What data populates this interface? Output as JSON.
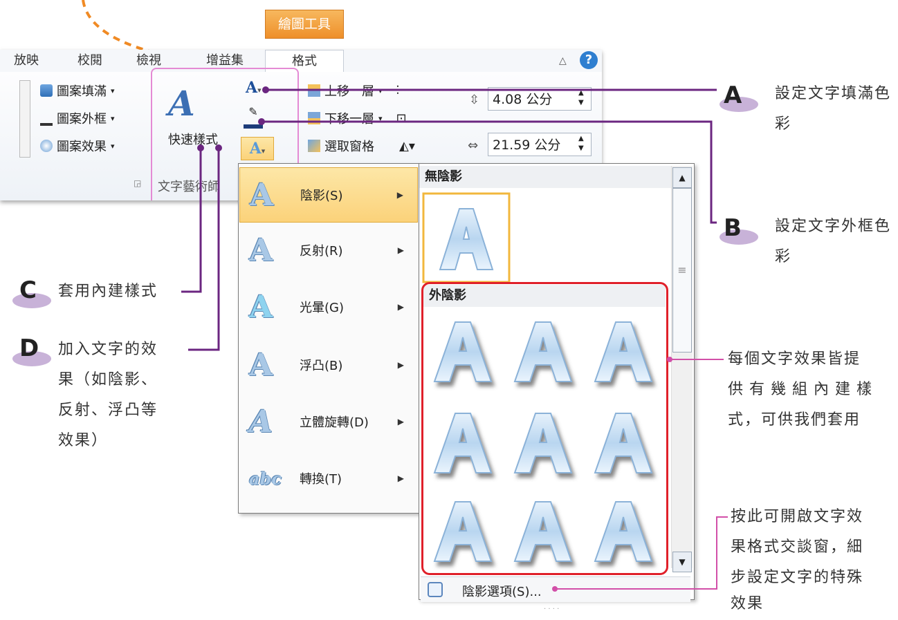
{
  "ribbon": {
    "tool_header": "繪圖工具",
    "tabs": [
      "放映",
      "校閱",
      "檢視",
      "增益集",
      "格式"
    ],
    "shape_fill": "圖案填滿",
    "shape_outline": "圖案外框",
    "shape_effect": "圖案效果",
    "quick_style": "快速樣式",
    "bring_forward": "上移一層",
    "send_backward": "下移一層",
    "selection_pane": "選取窗格",
    "height_value": "4.08 公分",
    "width_value": "21.59 公分",
    "wordart_group": "文字藝術師"
  },
  "menu": {
    "items": [
      "陰影(S)",
      "反射(R)",
      "光暈(G)",
      "浮凸(B)",
      "立體旋轉(D)",
      "轉換(T)"
    ]
  },
  "gallery": {
    "no_shadow": "無陰影",
    "outer_shadow": "外陰影",
    "shadow_options": "陰影選項(S)..."
  },
  "annotations": {
    "a_letter": "A",
    "a_text": "設定文字填滿色彩",
    "b_letter": "B",
    "b_text": "設定文字外框色彩",
    "c_letter": "C",
    "c_text": "套用內建樣式",
    "d_letter": "D",
    "d_text_1": "加入文字的效",
    "d_text_2": "果（如陰影、",
    "d_text_3": "反射、浮凸等",
    "d_text_4": "效果）",
    "preset_1": "每個文字效果皆提",
    "preset_2": "供有幾組內建樣",
    "preset_3": "式，可供我們套用",
    "dialog_1": "按此可開啟文字效",
    "dialog_2": "果格式交談窗，細",
    "dialog_3": "步設定文字的特殊",
    "dialog_4": "效果"
  }
}
